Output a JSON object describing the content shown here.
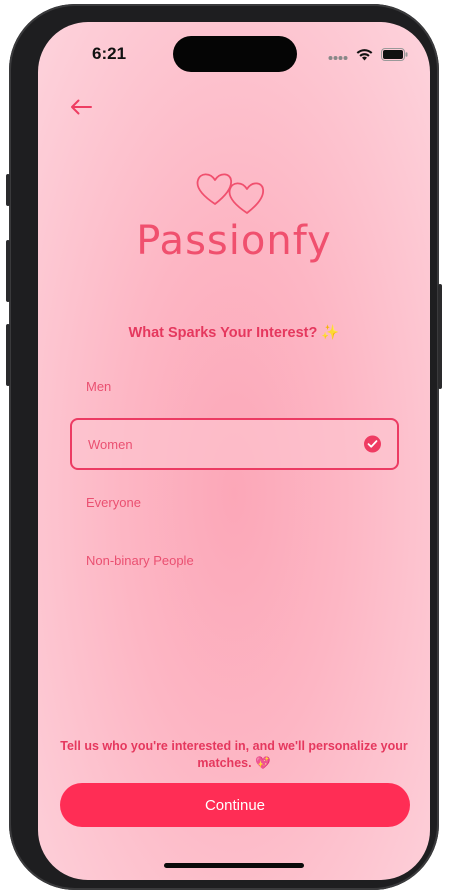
{
  "status_bar": {
    "time": "6:21",
    "icons": [
      "cellular-dots-icon",
      "wifi-icon",
      "battery-icon"
    ]
  },
  "nav": {
    "back_icon": "arrow-left-icon"
  },
  "brand": {
    "logo_icon": "two-hearts-icon",
    "name": "Passionfy"
  },
  "question": {
    "text": "What Sparks Your Interest? ✨"
  },
  "options": [
    {
      "label": "Men",
      "selected": false
    },
    {
      "label": "Women",
      "selected": true
    },
    {
      "label": "Everyone",
      "selected": false
    },
    {
      "label": "Non-binary People",
      "selected": false
    }
  ],
  "hint": {
    "text": "Tell us who you're interested in, and we'll personalize your matches. 💖"
  },
  "continue_button": {
    "label": "Continue"
  },
  "colors": {
    "accent": "#ff2d55",
    "brand_text": "#f0506e",
    "option_text": "#ea5071",
    "selected_border": "#ec3b63"
  }
}
